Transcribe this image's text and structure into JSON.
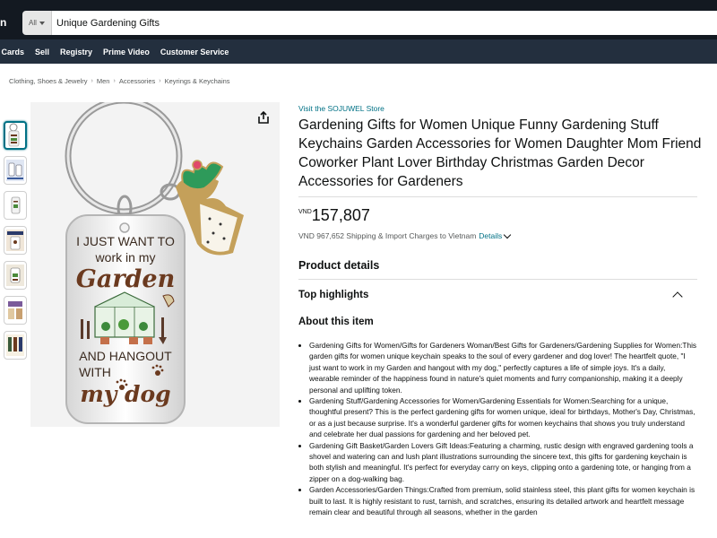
{
  "header": {
    "logo_fragment": "n",
    "search_category": "All",
    "search_value": "Unique Gardening Gifts"
  },
  "nav": {
    "items": [
      "t Cards",
      "Sell",
      "Registry",
      "Prime Video",
      "Customer Service"
    ]
  },
  "breadcrumb": [
    "Clothing, Shoes & Jewelry",
    "Men",
    "Accessories",
    "Keyrings & Keychains"
  ],
  "product": {
    "store_link": "Visit the SOJUWEL Store",
    "title": "Gardening Gifts for Women Unique Funny Gardening Stuff Keychains Garden Accessories for Women Daughter Mom Friend Coworker Plant Lover Birthday Christmas Garden Decor Accessories for Gardeners",
    "currency": "VND",
    "price": "157,807",
    "shipping_text": "VND 967,652 Shipping & Import Charges to Vietnam",
    "shipping_details": "Details",
    "image_text": {
      "line1": "I JUST WANT TO",
      "line2": "work in my",
      "line3": "Garden",
      "line4": "AND HANGOUT",
      "line5": "WITH",
      "line6": "my dog"
    }
  },
  "sections": {
    "product_details": "Product details",
    "top_highlights": "Top highlights",
    "about": "About this item"
  },
  "bullets": [
    "Gardening Gifts for Women/Gifts for Gardeners Woman/Best Gifts for Gardeners/Gardening Supplies for Women:This garden gifts for women unique keychain speaks to the soul of every gardener and dog lover! The heartfelt quote, \"I just want to work in my Garden and hangout with my dog,\" perfectly captures a life of simple joys. It's a daily, wearable reminder of the happiness found in nature's quiet moments and furry companionship, making it a deeply personal and uplifting token.",
    "Gardening Stuff/Gardening Accessories for Women/Gardening Essentials for Women:Searching for a unique, thoughtful present? This is the perfect gardening gifts for women unique, ideal for birthdays, Mother's Day, Christmas, or as a just because surprise. It's a wonderful gardener gifts for women keychains that shows you truly understand and celebrate her dual passions for gardening and her beloved pet.",
    "Gardening Gift Basket/Garden Lovers Gift Ideas:Featuring a charming, rustic design with engraved gardening tools a shovel and watering can and lush plant illustrations surrounding the sincere text, this gifts for gardening keychain is both stylish and meaningful. It's perfect for everyday carry on keys, clipping onto a gardening tote, or hanging from a zipper on a dog-walking bag.",
    "Garden Accessories/Garden Things:Crafted from premium, solid stainless steel, this plant gifts for women keychain is built to last. It is highly resistant to rust, tarnish, and scratches, ensuring its detailed artwork and heartfelt message remain clear and beautiful through all seasons, whether in the garden"
  ],
  "colors": {
    "header_bg": "#131921",
    "nav_bg": "#232f3e",
    "link": "#007185",
    "text_brown": "#6b3a1f"
  }
}
